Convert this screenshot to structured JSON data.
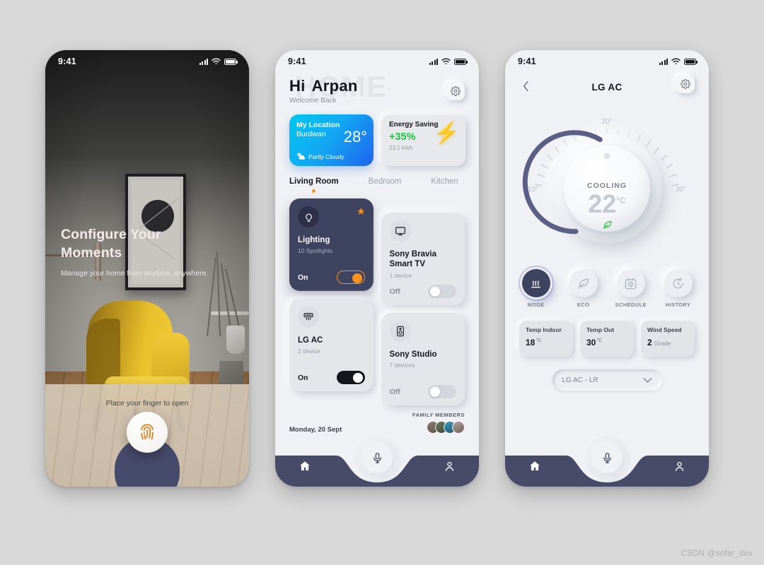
{
  "credit": "CSDN @sofar_dev",
  "phone1": {
    "statusbar": {
      "time": "9:41"
    },
    "title_line1": "Configure Your",
    "title_line2": "Moments",
    "subtitle": "Manage your home from anytime, anywhere.",
    "unlock_hint": "Place your finger to open",
    "fingerprint_icon": "fingerprint-icon"
  },
  "phone2": {
    "statusbar": {
      "time": "9:41"
    },
    "watermark": "HOME",
    "greeting": "Hi",
    "user_name": "Arpan",
    "greeting_sub": "Welcome Back",
    "settings_icon": "gear-icon",
    "weather": {
      "label": "My Location",
      "city": "Burdwan",
      "temp": "28°",
      "condition": "Partly Cloudy",
      "icon": "cloud-sun-icon",
      "gradient_from": "#00c8ee",
      "gradient_to": "#1f63ef"
    },
    "energy": {
      "title": "Energy Saving",
      "percent": "+35%",
      "kwh": "23.5 kWh",
      "icon": "lightning-bolt-icon",
      "accent": "#16c63c"
    },
    "rooms": [
      {
        "label": "Living Room",
        "active": true
      },
      {
        "label": "Bedroom",
        "active": false
      },
      {
        "label": "Kitchen",
        "active": false
      }
    ],
    "devices": [
      {
        "name": "Lighting",
        "sub": "10 Spotlights",
        "state": "On",
        "icon": "lightbulb-icon",
        "favorite": true
      },
      {
        "name": "Sony Bravia Smart TV",
        "sub": "1 device",
        "state": "Off",
        "icon": "tv-icon",
        "favorite": false
      },
      {
        "name": "LG AC",
        "sub": "2 device",
        "state": "On",
        "icon": "air-conditioner-icon",
        "favorite": false
      },
      {
        "name": "Sony Studio",
        "sub": "7 devices",
        "state": "Off",
        "icon": "speaker-icon",
        "favorite": false
      }
    ],
    "date": "Monday, 20 Sept",
    "family_label": "FAMILY MEMBERS",
    "nav": {
      "home": "home-icon",
      "mic": "microphone-icon",
      "profile": "person-icon"
    }
  },
  "phone3": {
    "statusbar": {
      "time": "9:41"
    },
    "back_icon": "chevron-left-icon",
    "title": "LG AC",
    "settings_icon": "gear-icon",
    "dial": {
      "mode": "COOLING",
      "value": "22",
      "unit": "°C",
      "tick_min": "10°",
      "tick_mid": "20°",
      "tick_max": "30°",
      "eco_icon": "leaf-icon",
      "eco_color": "#1fc42f",
      "arc_color": "#5b5f85"
    },
    "modes": [
      {
        "label": "MODE",
        "icon": "heat-waves-icon",
        "active": true
      },
      {
        "label": "ECO",
        "icon": "leaf-icon",
        "active": false
      },
      {
        "label": "SCHEDULE",
        "icon": "schedule-icon",
        "active": false
      },
      {
        "label": "HISTORY",
        "icon": "history-clock-icon",
        "active": false
      }
    ],
    "stats": [
      {
        "label": "Temp Indoor",
        "value": "18",
        "unit": "°C"
      },
      {
        "label": "Temp Out",
        "value": "30",
        "unit": "°C"
      },
      {
        "label": "Wind Speed",
        "value": "2",
        "unit": "Grade"
      }
    ],
    "selector": {
      "value": "LG AC - LR",
      "icon": "chevron-down-icon"
    },
    "nav": {
      "home": "home-icon",
      "mic": "microphone-icon",
      "profile": "person-icon"
    }
  }
}
